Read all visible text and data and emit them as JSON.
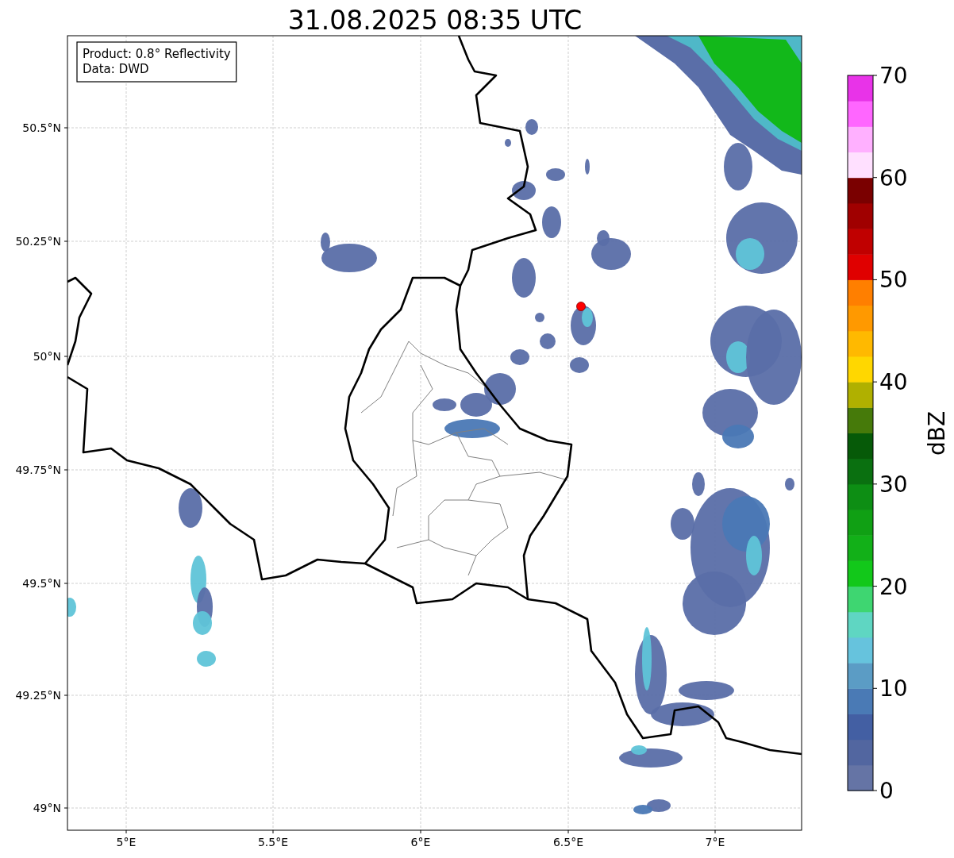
{
  "title": "31.08.2025 08:35 UTC",
  "legend": [
    "Product: 0.8° Reflectivity",
    "Data: DWD"
  ],
  "y_ticks": [
    "50.5°N",
    "50.25°N",
    "50°N",
    "49.75°N",
    "49.5°N",
    "49.25°N",
    "49°N"
  ],
  "x_ticks": [
    "5°E",
    "5.5°E",
    "6°E",
    "6.5°E",
    "7°E"
  ],
  "colorbar": {
    "label": "dBZ",
    "ticks": [
      "70",
      "60",
      "50",
      "40",
      "30",
      "20",
      "10",
      "0"
    ],
    "segments": [
      {
        "color": "#6574a5"
      },
      {
        "color": "#5266a0"
      },
      {
        "color": "#435fa3"
      },
      {
        "color": "#4a7ab5"
      },
      {
        "color": "#5b9cc5"
      },
      {
        "color": "#66c3dd"
      },
      {
        "color": "#5fd6c2"
      },
      {
        "color": "#3ed671"
      },
      {
        "color": "#12c81a"
      },
      {
        "color": "#12b018"
      },
      {
        "color": "#10a014"
      },
      {
        "color": "#0d8e14"
      },
      {
        "color": "#0a7010"
      },
      {
        "color": "#065a08"
      },
      {
        "color": "#467a0a"
      },
      {
        "color": "#b0b000"
      },
      {
        "color": "#ffd700"
      },
      {
        "color": "#ffb900"
      },
      {
        "color": "#ff9900"
      },
      {
        "color": "#ff7f00"
      },
      {
        "color": "#e00000"
      },
      {
        "color": "#c00000"
      },
      {
        "color": "#a00000"
      },
      {
        "color": "#7a0000"
      },
      {
        "color": "#ffe0ff"
      },
      {
        "color": "#ffb0ff"
      },
      {
        "color": "#ff66ff"
      },
      {
        "color": "#e833e8"
      }
    ]
  }
}
